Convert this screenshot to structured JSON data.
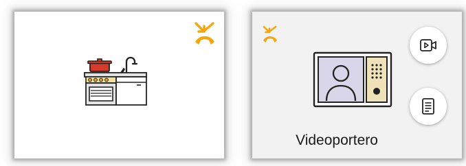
{
  "tiles": {
    "kitchen": {
      "icon": "kitchen-icon",
      "hangup_icon": "hang-up-icon"
    },
    "video_intercom": {
      "name": "Videoportero",
      "icon": "video-intercom-icon",
      "hangup_icon": "hang-up-icon",
      "buttons": {
        "camera_icon": "video-camera-icon",
        "notes_icon": "document-icon"
      }
    }
  },
  "colors": {
    "accent": "#f5a60d",
    "pot_red": "#d63a2a",
    "intercom_panel": "#d8d6e8",
    "intercom_keypad": "#efe1b8",
    "kitchen_steel": "#e3e3e3"
  }
}
